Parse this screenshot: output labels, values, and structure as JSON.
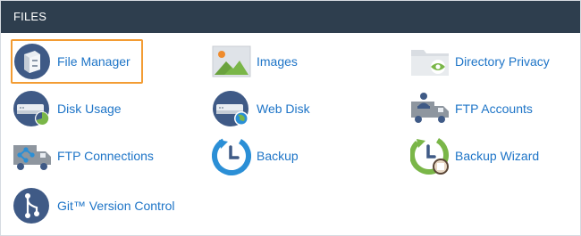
{
  "panel": {
    "title": "FILES"
  },
  "items": [
    {
      "label": "File Manager",
      "icon": "file-manager-icon",
      "highlighted": true
    },
    {
      "label": "Images",
      "icon": "images-icon"
    },
    {
      "label": "Directory Privacy",
      "icon": "directory-privacy-icon"
    },
    {
      "label": "Disk Usage",
      "icon": "disk-usage-icon"
    },
    {
      "label": "Web Disk",
      "icon": "web-disk-icon"
    },
    {
      "label": "FTP Accounts",
      "icon": "ftp-accounts-icon"
    },
    {
      "label": "FTP Connections",
      "icon": "ftp-connections-icon"
    },
    {
      "label": "Backup",
      "icon": "backup-icon"
    },
    {
      "label": "Backup Wizard",
      "icon": "backup-wizard-icon"
    },
    {
      "label": "Git™ Version Control",
      "icon": "git-version-control-icon"
    }
  ],
  "colors": {
    "header_bg": "#2e3e4e",
    "link": "#1d74c7",
    "highlight_border": "#f39c33",
    "icon_navy": "#3f5a86",
    "icon_green": "#7ab648",
    "icon_blue": "#2b8fd6"
  }
}
